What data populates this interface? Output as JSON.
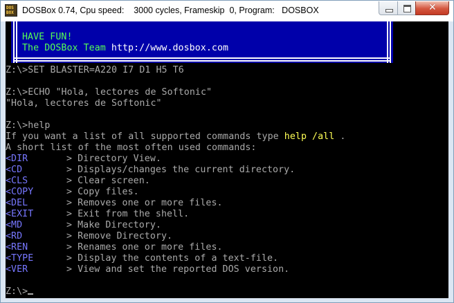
{
  "window": {
    "title": "DOSBox 0.74, Cpu speed:    3000 cycles, Frameskip  0, Program:   DOSBOX",
    "icon_label": "DOS\nBOX",
    "controls": {
      "minimize": "minimize-icon",
      "maximize": "maximize-icon",
      "close": "✕"
    },
    "colors": {
      "banner": "#0000aa",
      "text": "#aaaaaa",
      "highlight": "#ffff55",
      "banner_text": "#55ff55",
      "command": "#7777ff"
    }
  },
  "banner": {
    "line1": "HAVE FUN!",
    "line2_text": "The DOSBox Team ",
    "line2_url": "http://www.dosbox.com"
  },
  "terminal": {
    "set_cmd": "Z:\\>SET BLASTER=A220 I7 D1 H5 T6",
    "echo_cmd": "Z:\\>ECHO \"Hola, lectores de Softonic\"",
    "echo_out": "\"Hola, lectores de Softonic\"",
    "help_cmd": "Z:\\>help",
    "help_intro_pre": "If you want a list of all supported commands type ",
    "help_intro_hl": "help /all",
    "help_intro_post": " .",
    "short_list": "A short list of the most often used commands:",
    "commands": [
      {
        "name": "<DIR",
        "desc": "> Directory View."
      },
      {
        "name": "<CD",
        "desc": "> Displays/changes the current directory."
      },
      {
        "name": "<CLS",
        "desc": "> Clear screen."
      },
      {
        "name": "<COPY",
        "desc": "> Copy files."
      },
      {
        "name": "<DEL",
        "desc": "> Removes one or more files."
      },
      {
        "name": "<EXIT",
        "desc": "> Exit from the shell."
      },
      {
        "name": "<MD",
        "desc": "> Make Directory."
      },
      {
        "name": "<RD",
        "desc": "> Remove Directory."
      },
      {
        "name": "<REN",
        "desc": "> Renames one or more files."
      },
      {
        "name": "<TYPE",
        "desc": "> Display the contents of a text-file."
      },
      {
        "name": "<VER",
        "desc": "> View and set the reported DOS version."
      }
    ],
    "prompt": "Z:\\>"
  }
}
